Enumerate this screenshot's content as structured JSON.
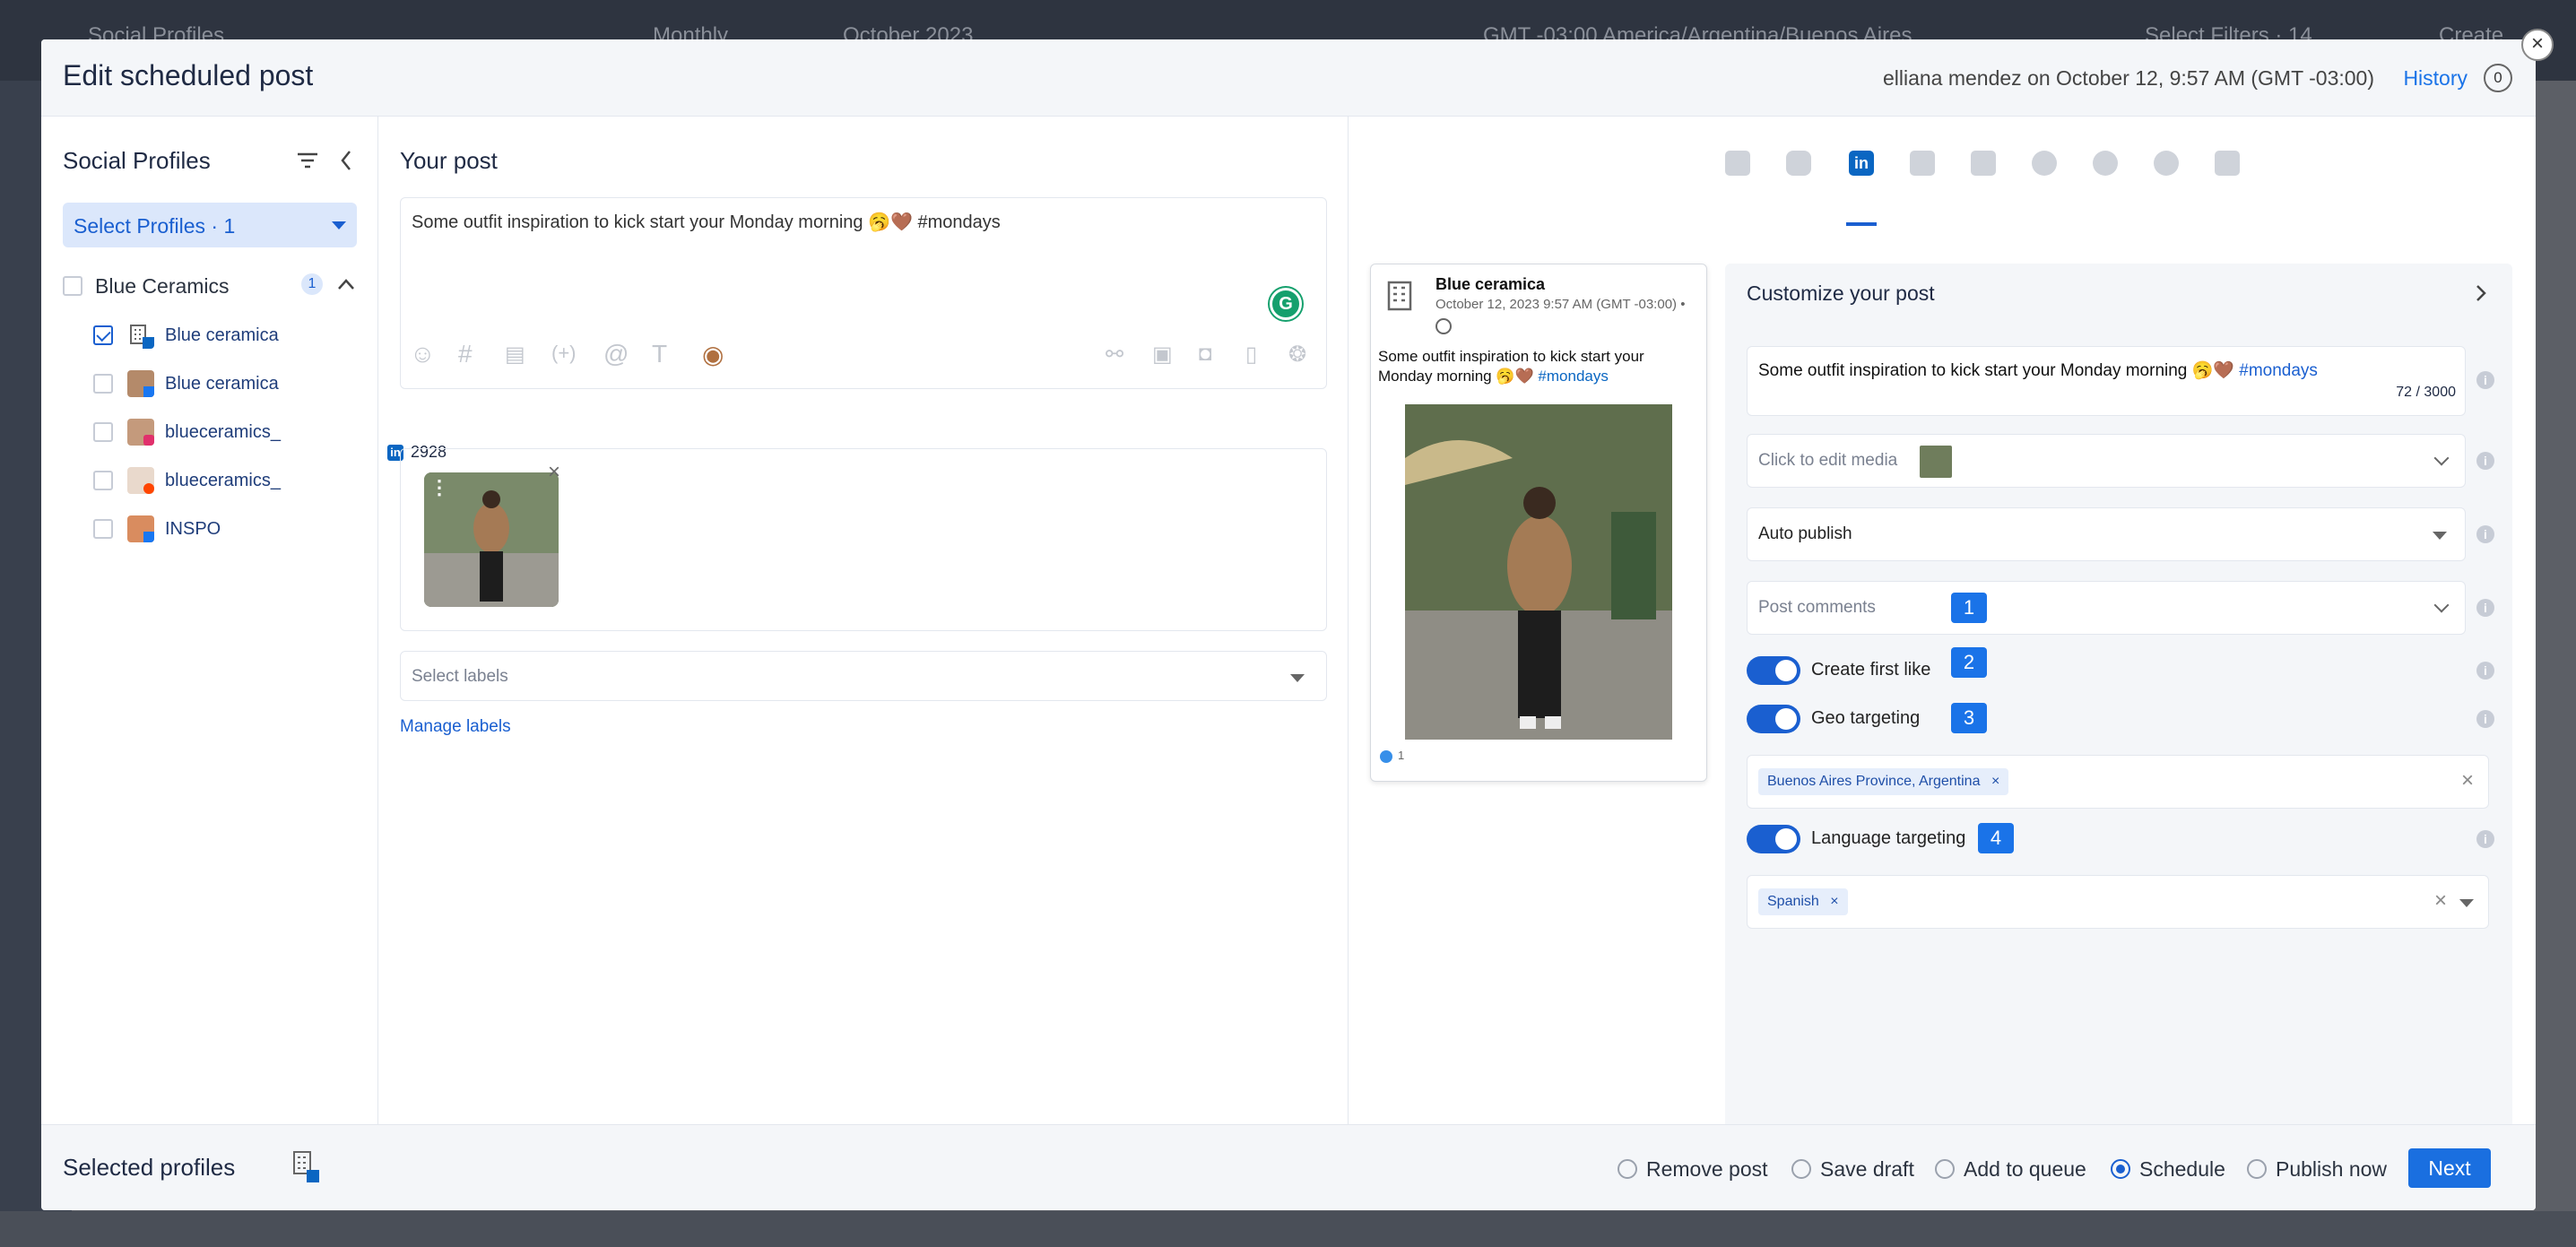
{
  "background": {
    "app_title": "Social Profiles",
    "view_mode": "Monthly",
    "month": "October 2023",
    "timezone": "GMT -03:00 America/Argentina/Buenos Aires",
    "filters": "Select Filters · 14",
    "create": "Create"
  },
  "modal": {
    "title": "Edit scheduled post",
    "meta": "elliana mendez on October 12, 9:57 AM (GMT -03:00)",
    "history": "History",
    "history_count": "0"
  },
  "profiles": {
    "title": "Social Profiles",
    "select_label": "Select Profiles · 1",
    "group": {
      "name": "Blue Ceramics",
      "count": "1"
    },
    "items": [
      {
        "name": "Blue ceramica",
        "checked": true,
        "network": "linkedin"
      },
      {
        "name": "Blue ceramica",
        "checked": false,
        "network": "facebook"
      },
      {
        "name": "blueceramics_",
        "checked": false,
        "network": "instagram"
      },
      {
        "name": "blueceramics_",
        "checked": false,
        "network": "reddit"
      },
      {
        "name": "INSPO",
        "checked": false,
        "network": "facebook"
      }
    ]
  },
  "post": {
    "title": "Your post",
    "text": "Some outfit inspiration to kick start your Monday morning 🥱🤎 #mondays",
    "char_remaining": "2928",
    "labels_placeholder": "Select labels",
    "manage_labels": "Manage labels"
  },
  "preview": {
    "author": "Blue ceramica",
    "date": "October 12, 2023 9:57 AM (GMT -03:00) •",
    "text": "Some outfit inspiration to kick start your Monday morning 🥱🤎",
    "hashtag": "#mondays",
    "reactions": "1"
  },
  "customize": {
    "title": "Customize your post",
    "text": "Some outfit inspiration to kick start your Monday morning 🥱🤎",
    "hashtag": "#mondays",
    "char_count": "72 / 3000",
    "edit_media": "Click to edit media",
    "publish_mode": "Auto publish",
    "post_comments": "Post comments",
    "first_like": "Create first like",
    "geo": "Geo targeting",
    "geo_value": "Buenos Aires Province, Argentina",
    "language": "Language targeting",
    "language_value": "Spanish",
    "markers": [
      "1",
      "2",
      "3",
      "4"
    ]
  },
  "footer": {
    "selected_profiles": "Selected profiles",
    "options": [
      "Remove post",
      "Save draft",
      "Add to queue",
      "Schedule",
      "Publish now"
    ],
    "selected_option": "Schedule",
    "next": "Next"
  },
  "colors": {
    "accent": "#1a5fd0",
    "linkedin": "#0a66c2",
    "toggle": "#1a5fd0",
    "marker": "#1a73e8"
  }
}
